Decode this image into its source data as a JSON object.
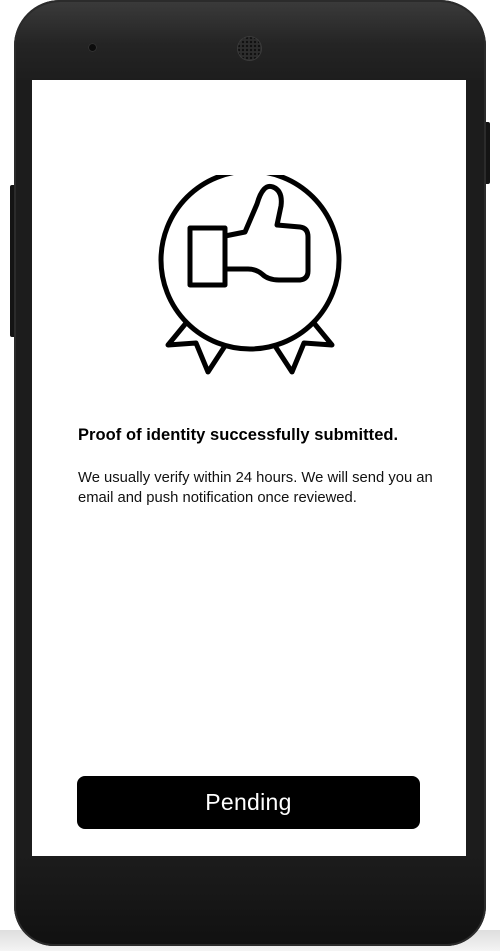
{
  "icon": {
    "name": "thumbs-up-award-badge-icon"
  },
  "message": {
    "title": "Proof of identity successfully submitted.",
    "body": "We usually verify within 24 hours. We will send you an email and push notification once reviewed."
  },
  "action": {
    "label": "Pending"
  },
  "colors": {
    "device_frame": "#1c1c1c",
    "screen_background": "#ffffff",
    "button_background": "#000000",
    "button_text": "#ffffff",
    "text": "#000000"
  }
}
